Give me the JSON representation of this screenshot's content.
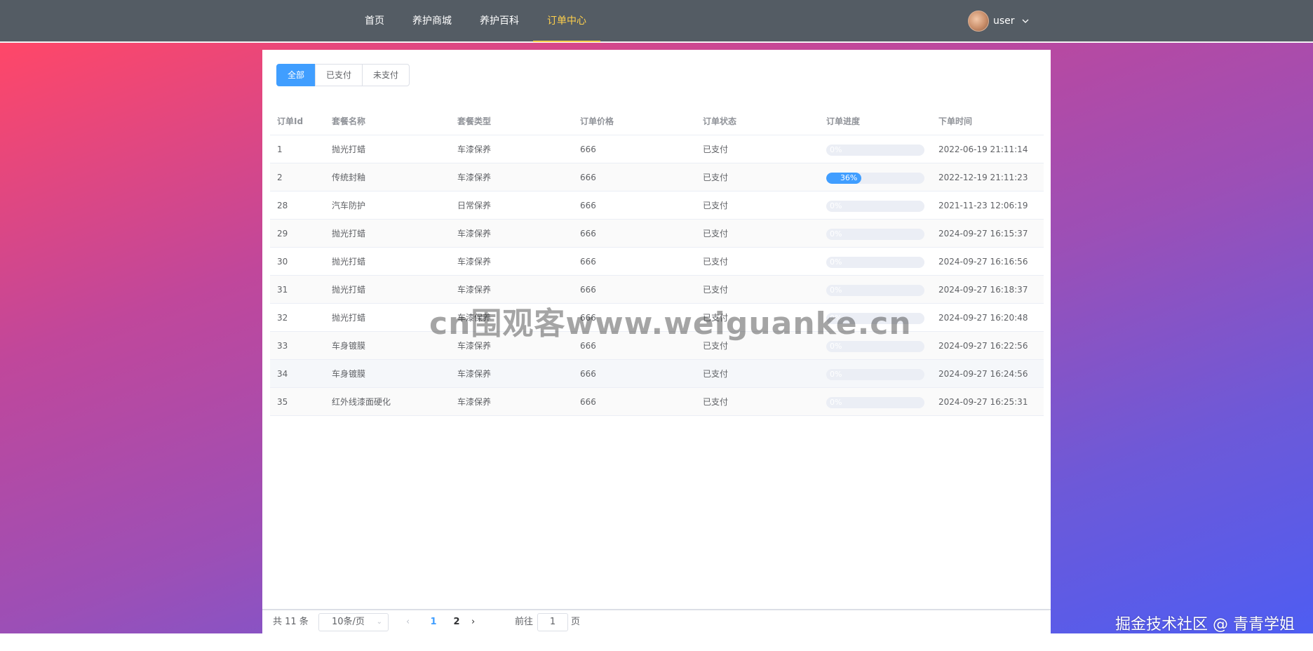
{
  "nav": {
    "items": [
      {
        "label": "首页",
        "active": false
      },
      {
        "label": "养护商城",
        "active": false
      },
      {
        "label": "养护百科",
        "active": false
      },
      {
        "label": "订单中心",
        "active": true
      }
    ],
    "user": "user",
    "active_color": "#ffd04b",
    "bar_color": "#545c64"
  },
  "filter": {
    "options": [
      "全部",
      "已支付",
      "未支付"
    ],
    "selected": "全部"
  },
  "table": {
    "headers": [
      "订单Id",
      "套餐名称",
      "套餐类型",
      "订单价格",
      "订单状态",
      "订单进度",
      "下单时间"
    ],
    "rows": [
      {
        "id": "1",
        "name": "抛光打蜡",
        "type": "车漆保养",
        "price": "666",
        "status": "已支付",
        "progress": 0,
        "progress_label": "0%",
        "time": "2022-06-19 21:11:14"
      },
      {
        "id": "2",
        "name": "传统封釉",
        "type": "车漆保养",
        "price": "666",
        "status": "已支付",
        "progress": 36,
        "progress_label": "36%",
        "time": "2022-12-19 21:11:23"
      },
      {
        "id": "28",
        "name": "汽车防护",
        "type": "日常保养",
        "price": "666",
        "status": "已支付",
        "progress": 0,
        "progress_label": "0%",
        "time": "2021-11-23 12:06:19"
      },
      {
        "id": "29",
        "name": "抛光打蜡",
        "type": "车漆保养",
        "price": "666",
        "status": "已支付",
        "progress": 0,
        "progress_label": "0%",
        "time": "2024-09-27 16:15:37"
      },
      {
        "id": "30",
        "name": "抛光打蜡",
        "type": "车漆保养",
        "price": "666",
        "status": "已支付",
        "progress": 0,
        "progress_label": "0%",
        "time": "2024-09-27 16:16:56"
      },
      {
        "id": "31",
        "name": "抛光打蜡",
        "type": "车漆保养",
        "price": "666",
        "status": "已支付",
        "progress": 0,
        "progress_label": "0%",
        "time": "2024-09-27 16:18:37"
      },
      {
        "id": "32",
        "name": "抛光打蜡",
        "type": "车漆保养",
        "price": "666",
        "status": "已支付",
        "progress": 0,
        "progress_label": "0%",
        "time": "2024-09-27 16:20:48"
      },
      {
        "id": "33",
        "name": "车身镀膜",
        "type": "车漆保养",
        "price": "666",
        "status": "已支付",
        "progress": 0,
        "progress_label": "0%",
        "time": "2024-09-27 16:22:56"
      },
      {
        "id": "34",
        "name": "车身镀膜",
        "type": "车漆保养",
        "price": "666",
        "status": "已支付",
        "progress": 0,
        "progress_label": "0%",
        "time": "2024-09-27 16:24:56"
      },
      {
        "id": "35",
        "name": "红外线漆面硬化",
        "type": "车漆保养",
        "price": "666",
        "status": "已支付",
        "progress": 0,
        "progress_label": "0%",
        "time": "2024-09-27 16:25:31"
      }
    ]
  },
  "pagination": {
    "total": "共 11 条",
    "page_size": "10条/页",
    "pages": [
      "1",
      "2"
    ],
    "current": "1",
    "goto_label": "前往",
    "goto_value": "1",
    "goto_unit": "页",
    "accent": "#409eff"
  },
  "watermark": "cn围观客www.weiguanke.cn",
  "credit": "掘金技术社区 @ 青青学姐"
}
